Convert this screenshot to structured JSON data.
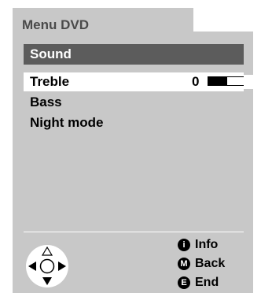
{
  "window": {
    "title": "Menu DVD"
  },
  "section": {
    "title": "Sound"
  },
  "items": [
    {
      "label": "Treble",
      "value": "0",
      "level": 0.45,
      "selected": true
    },
    {
      "label": "Bass"
    },
    {
      "label": "Night mode"
    }
  ],
  "legend": [
    {
      "key": "i",
      "label": "Info"
    },
    {
      "key": "M",
      "label": "Back"
    },
    {
      "key": "E",
      "label": "End"
    }
  ],
  "icons": {
    "nav": "dpad-icon"
  }
}
